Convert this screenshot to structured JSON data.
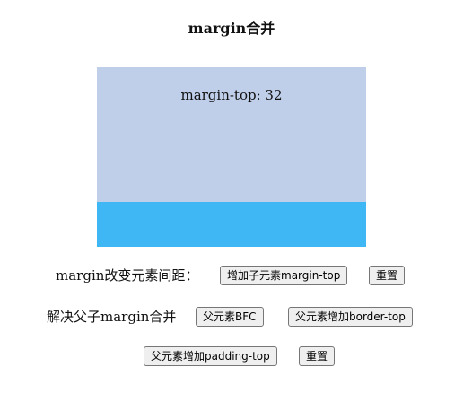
{
  "page": {
    "title": "margin合并"
  },
  "demo": {
    "child_label": "margin-top: 32",
    "parent_color": "#bfcfea",
    "bar_color": "#3fb7f5"
  },
  "controls": {
    "row1": {
      "label": "margin改变元素间距：",
      "add_child_margin_button": "增加子元素margin-top",
      "reset_button": "重置"
    },
    "row2": {
      "label": "解决父子margin合并",
      "parent_bfc_button": "父元素BFC",
      "parent_border_button": "父元素增加border-top"
    },
    "row3": {
      "parent_padding_button": "父元素增加padding-top",
      "reset_button": "重置"
    }
  }
}
